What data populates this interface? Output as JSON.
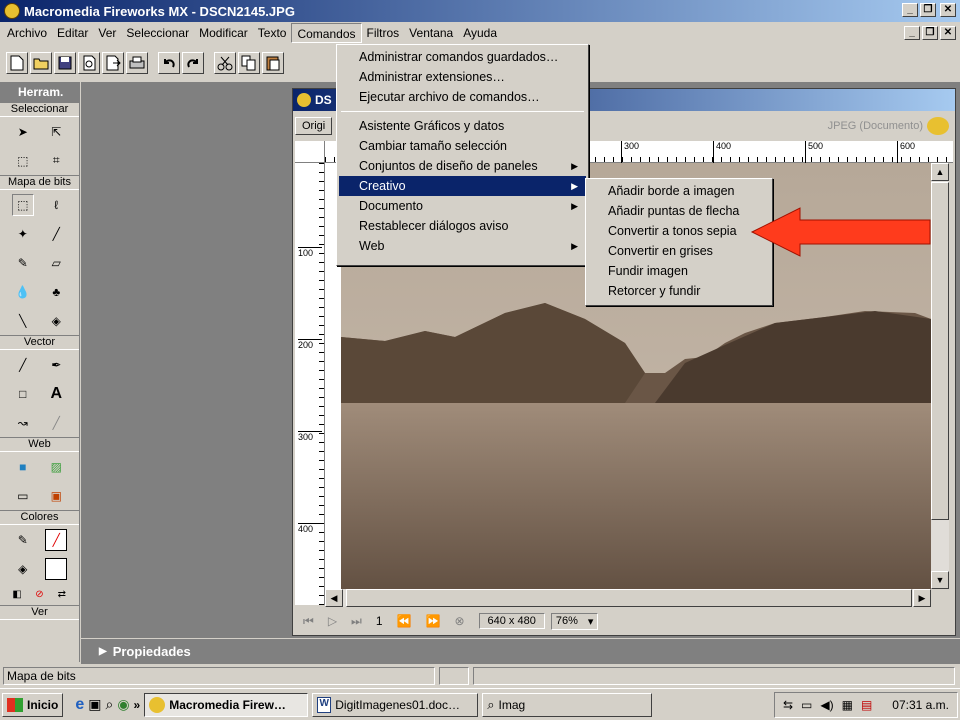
{
  "window": {
    "title": "Macromedia Fireworks MX - DSCN2145.JPG"
  },
  "menubar": [
    "Archivo",
    "Editar",
    "Ver",
    "Seleccionar",
    "Modificar",
    "Texto",
    "Comandos",
    "Filtros",
    "Ventana",
    "Ayuda"
  ],
  "comandos_menu": {
    "group1": [
      "Administrar comandos guardados…",
      "Administrar extensiones…",
      "Ejecutar archivo de comandos…"
    ],
    "group2": [
      "Asistente Gráficos y datos",
      "Cambiar tamaño selección",
      "Conjuntos de diseño de paneles",
      "Creativo",
      "Documento",
      "Restablecer diálogos aviso",
      "Web"
    ],
    "highlighted": "Creativo"
  },
  "creativo_submenu": [
    "Añadir borde a imagen",
    "Añadir puntas de flecha",
    "Convertir a tonos sepia",
    "Convertir en grises",
    "Fundir imagen",
    "Retorcer y fundir"
  ],
  "tools": {
    "header": "Herram.",
    "sections": [
      "Seleccionar",
      "Mapa de bits",
      "Vector",
      "Web",
      "Colores",
      "Ver"
    ]
  },
  "document": {
    "title_visible": "DS",
    "tab_visible": "Origi",
    "format": "JPEG (Documento)",
    "ruler_h": [
      "300",
      "400",
      "500",
      "600"
    ],
    "ruler_v": [
      "100",
      "200",
      "300",
      "400"
    ],
    "frame": "1",
    "size": "640 x 480",
    "zoom": "76%"
  },
  "props": {
    "label": "Propiedades"
  },
  "status": {
    "text": "Mapa de bits"
  },
  "taskbar": {
    "start": "Inicio",
    "tasks": [
      "Macromedia Firew…",
      "DigitImagenes01.doc…",
      "Imag"
    ],
    "clock": "07:31 a.m."
  },
  "colors": {
    "arrow": "#ff3b1c",
    "highlight": "#0a246a",
    "sepia": "#8a7766"
  }
}
